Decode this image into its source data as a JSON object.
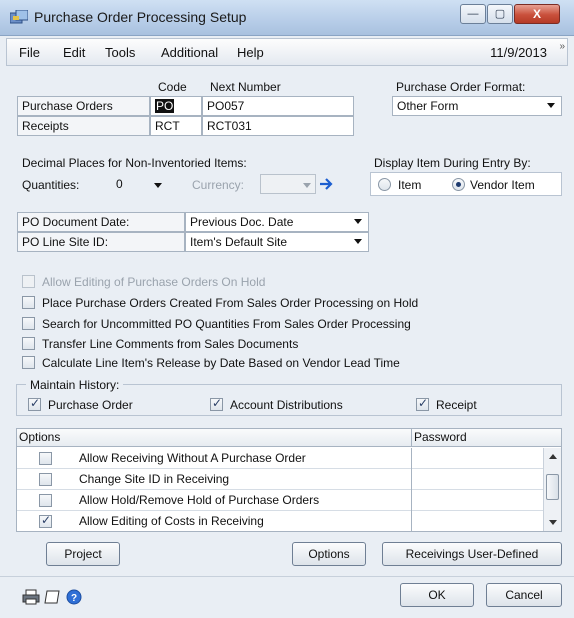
{
  "window": {
    "title": "Purchase Order Processing Setup",
    "minimize": "—",
    "maximize": "▢",
    "close": "X"
  },
  "menu": {
    "items": [
      "File",
      "Edit",
      "Tools",
      "Additional",
      "Help"
    ],
    "date": "11/9/2013",
    "more": "»"
  },
  "ids": {
    "code_header": "Code",
    "next_header": "Next Number",
    "rows": [
      {
        "label": "Purchase Orders",
        "code": "PO",
        "next": "PO057"
      },
      {
        "label": "Receipts",
        "code": "RCT",
        "next": "RCT031"
      }
    ]
  },
  "po_format": {
    "label": "Purchase Order Format:",
    "value": "Other Form"
  },
  "decimals": {
    "label": "Decimal Places for Non-Inventoried Items:",
    "quantities_label": "Quantities:",
    "quantities_value": "0",
    "currency_label": "Currency:",
    "currency_value": ""
  },
  "display_by": {
    "label": "Display Item During Entry By:",
    "options": [
      {
        "label": "Item",
        "selected": false
      },
      {
        "label": "Vendor Item",
        "selected": true
      }
    ]
  },
  "po_doc_date": {
    "label": "PO Document Date:",
    "value": "Previous Doc. Date"
  },
  "po_line_site": {
    "label": "PO Line Site ID:",
    "value": "Item's Default Site"
  },
  "checkboxes": [
    {
      "label": "Allow Editing of Purchase Orders On Hold",
      "checked": false,
      "disabled": true
    },
    {
      "label": "Place Purchase Orders Created From Sales Order Processing on Hold",
      "checked": false,
      "disabled": false
    },
    {
      "label": "Search for Uncommitted PO Quantities From Sales Order Processing",
      "checked": false,
      "disabled": false
    },
    {
      "label": "Transfer Line Comments from Sales Documents",
      "checked": false,
      "disabled": false
    },
    {
      "label": "Calculate Line Item's Release by Date Based on Vendor Lead Time",
      "checked": false,
      "disabled": false
    }
  ],
  "history": {
    "label": "Maintain History:",
    "items": [
      {
        "label": "Purchase Order",
        "checked": true
      },
      {
        "label": "Account Distributions",
        "checked": true
      },
      {
        "label": "Receipt",
        "checked": true
      }
    ]
  },
  "options_grid": {
    "col_options": "Options",
    "col_password": "Password",
    "rows": [
      {
        "label": "Allow Receiving Without A Purchase Order",
        "checked": false,
        "password": ""
      },
      {
        "label": "Change Site ID in Receiving",
        "checked": false,
        "password": ""
      },
      {
        "label": "Allow Hold/Remove Hold of Purchase Orders",
        "checked": false,
        "password": ""
      },
      {
        "label": "Allow Editing of Costs in Receiving",
        "checked": true,
        "password": ""
      }
    ]
  },
  "buttons": {
    "project": "Project",
    "options": "Options",
    "receivings_udf": "Receivings User-Defined",
    "ok": "OK",
    "cancel": "Cancel"
  },
  "colors": {
    "accent": "#1d5fd0",
    "window_bg": "#e9eef4"
  }
}
